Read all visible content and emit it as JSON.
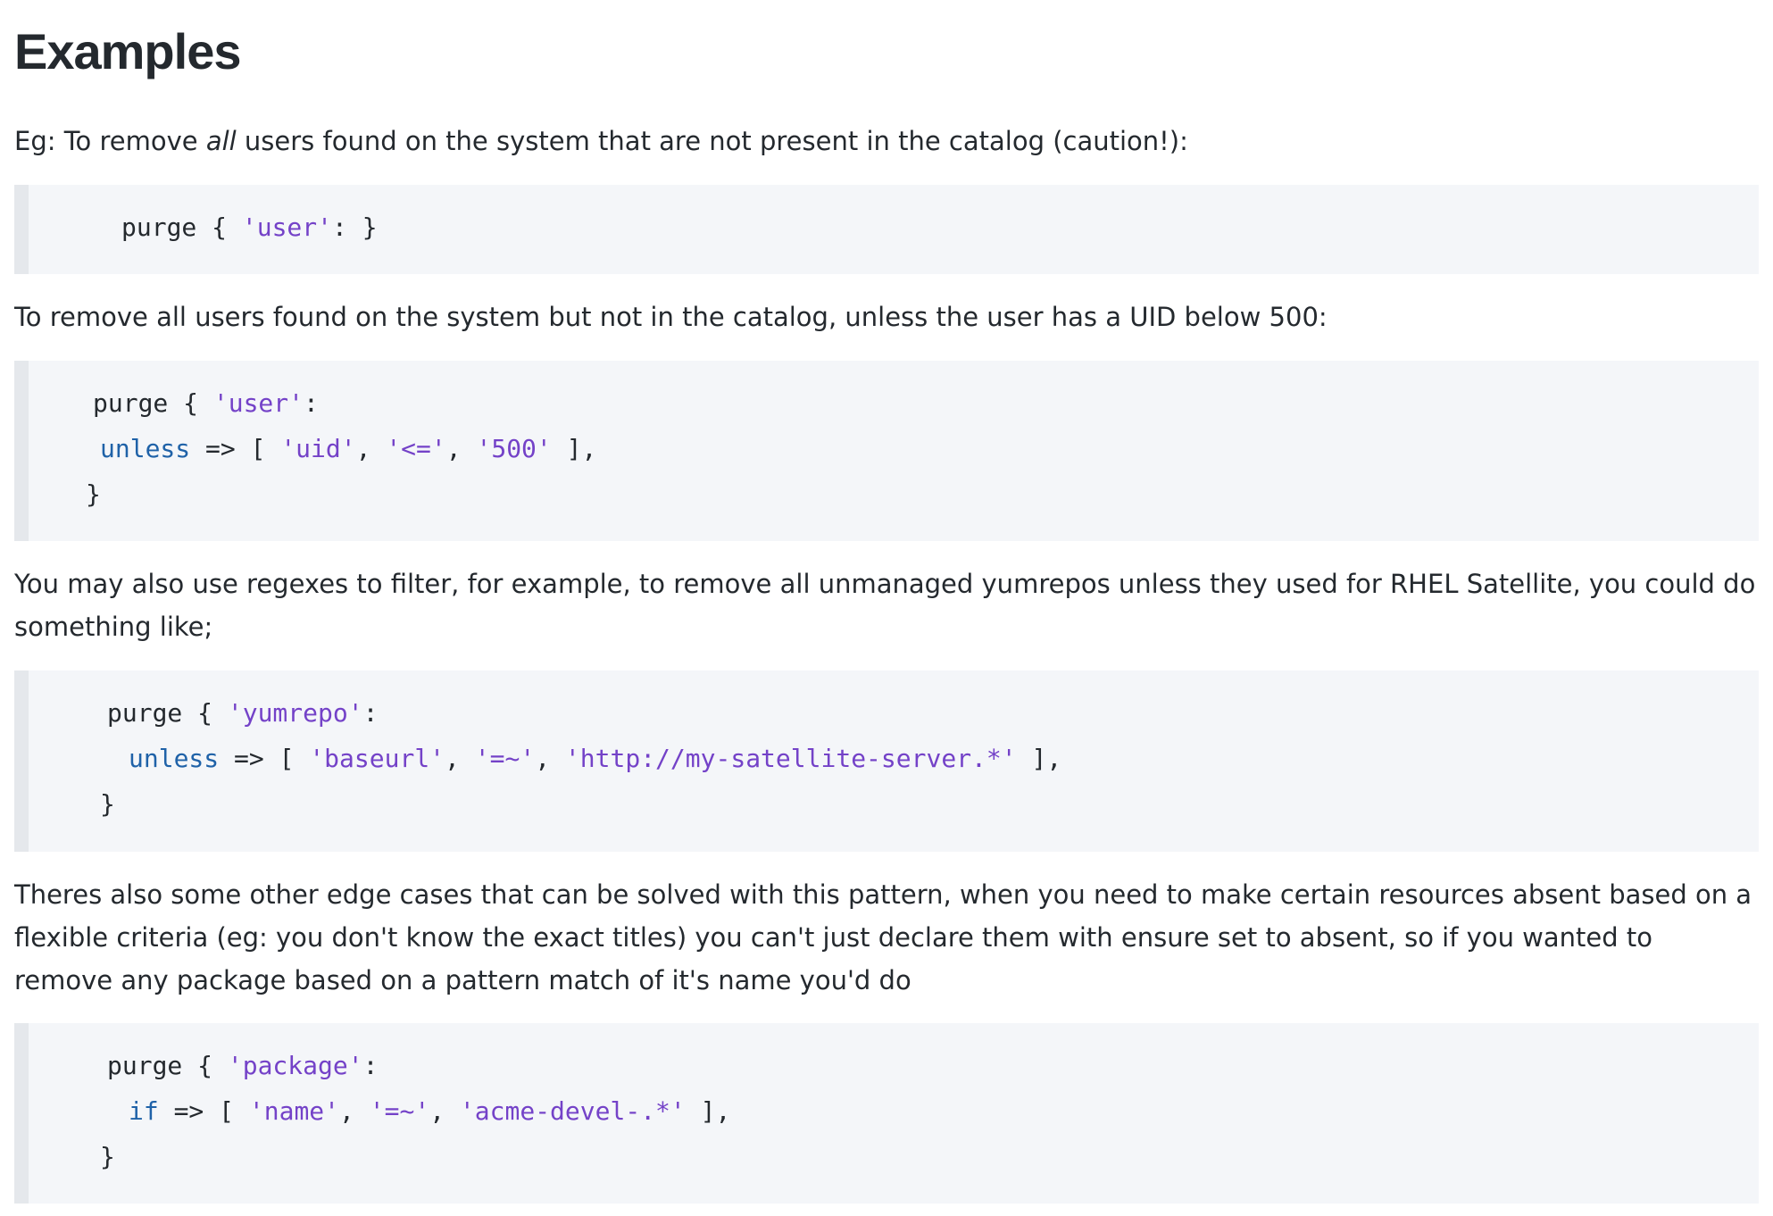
{
  "heading": "Examples",
  "intro": {
    "prefix": "Eg: To remove ",
    "emphasis": "all",
    "suffix": " users found on the system that are not present in the catalog (caution!):"
  },
  "code1": {
    "line1": {
      "pre": "purge { ",
      "str": "'user'",
      "post": ": }"
    }
  },
  "para2": "To remove all users found on the system but not in the catalog, unless the user has a UID below 500:",
  "code2": {
    "line1": {
      "pre": "purge { ",
      "str": "'user'",
      "post": ":"
    },
    "line2": {
      "kw": "unless",
      "a": " => [ ",
      "s1": "'uid'",
      "b": ", ",
      "s2": "'<='",
      "c": ", ",
      "s3": "'500'",
      "d": " ],"
    },
    "line3": "}"
  },
  "para3": "You may also use regexes to filter, for example, to remove all unmanaged yumrepos unless they used for RHEL Satellite, you could do something like;",
  "code3": {
    "line1": {
      "pre": "purge { ",
      "str": "'yumrepo'",
      "post": ":"
    },
    "line2": {
      "kw": "unless",
      "a": " => [ ",
      "s1": "'baseurl'",
      "b": ", ",
      "s2": "'=~'",
      "c": ", ",
      "s3": "'http://my-satellite-server.*'",
      "d": " ],"
    },
    "line3": "}"
  },
  "para4": "Theres also some other edge cases that can be solved with this pattern, when you need to make certain resources absent based on a flexible criteria (eg: you don't know the exact titles) you can't just declare them with ensure set to absent, so if you wanted to remove any package based on a pattern match of it's name you'd do",
  "code4": {
    "line1": {
      "pre": "purge { ",
      "str": "'package'",
      "post": ":"
    },
    "line2": {
      "kw": "if",
      "a": " => [ ",
      "s1": "'name'",
      "b": ", ",
      "s2": "'=~'",
      "c": ", ",
      "s3": "'acme-devel-.*'",
      "d": " ],"
    },
    "line3": "}"
  },
  "colors": {
    "text": "#24292e",
    "keyword": "#1f62a8",
    "string": "#7442c8",
    "code_background": "#f4f6f9",
    "code_border": "#e5e8ec"
  }
}
